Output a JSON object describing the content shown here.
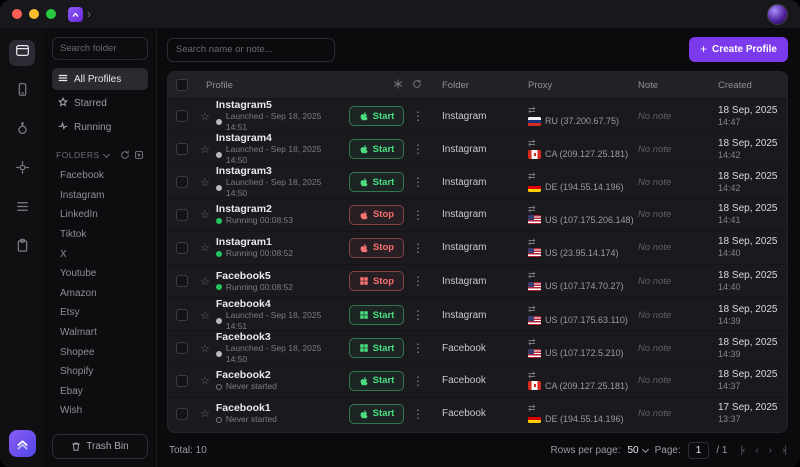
{
  "titlebar": {
    "chevron": "›"
  },
  "sidebar": {
    "search_placeholder": "Search folder",
    "nav": [
      {
        "label": "All Profiles"
      },
      {
        "label": "Starred"
      },
      {
        "label": "Running"
      }
    ],
    "folders_heading": "FOLDERS",
    "folders": [
      "Facebook",
      "Instagram",
      "LinkedIn",
      "Tiktok",
      "X",
      "Youtube",
      "Amazon",
      "Etsy",
      "Walmart",
      "Shopee",
      "Shopify",
      "Ebay",
      "Wish"
    ],
    "trash_button": "Trash Bin"
  },
  "toolbar": {
    "search_placeholder": "Search name or note...",
    "create_button": "Create Profile"
  },
  "table": {
    "headers": {
      "profile": "Profile",
      "folder": "Folder",
      "proxy": "Proxy",
      "note": "Note",
      "created": "Created"
    },
    "rows": [
      {
        "name": "Instagram5",
        "status": "Launched - Sep 18, 2025 14:51",
        "status_type": "launched",
        "action": "Start",
        "action_type": "start",
        "os": "apple",
        "folder": "Instagram",
        "proxy_country": "RU",
        "proxy": "RU (37.200.67.75)",
        "note": "No note",
        "created_date": "18 Sep, 2025",
        "created_time": "14:47"
      },
      {
        "name": "Instagram4",
        "status": "Launched - Sep 18, 2025 14:50",
        "status_type": "launched",
        "action": "Start",
        "action_type": "start",
        "os": "apple",
        "folder": "Instagram",
        "proxy_country": "CA",
        "proxy": "CA (209.127.25.181)",
        "note": "No note",
        "created_date": "18 Sep, 2025",
        "created_time": "14:42"
      },
      {
        "name": "Instagram3",
        "status": "Launched - Sep 18, 2025 14:50",
        "status_type": "launched",
        "action": "Start",
        "action_type": "start",
        "os": "apple",
        "folder": "Instagram",
        "proxy_country": "DE",
        "proxy": "DE (194.55.14.196)",
        "note": "No note",
        "created_date": "18 Sep, 2025",
        "created_time": "14:42"
      },
      {
        "name": "Instagram2",
        "status": "Running 00:08:53",
        "status_type": "running",
        "action": "Stop",
        "action_type": "stop",
        "os": "apple",
        "folder": "Instagram",
        "proxy_country": "US",
        "proxy": "US (107.175.206.148)",
        "note": "No note",
        "created_date": "18 Sep, 2025",
        "created_time": "14:41"
      },
      {
        "name": "Instagram1",
        "status": "Running 00:08:52",
        "status_type": "running",
        "action": "Stop",
        "action_type": "stop",
        "os": "apple",
        "folder": "Instagram",
        "proxy_country": "US",
        "proxy": "US (23.95.14.174)",
        "note": "No note",
        "created_date": "18 Sep, 2025",
        "created_time": "14:40"
      },
      {
        "name": "Facebook5",
        "status": "Running 00:08:52",
        "status_type": "running",
        "action": "Stop",
        "action_type": "stop",
        "os": "windows",
        "folder": "Instagram",
        "proxy_country": "US",
        "proxy": "US (107.174.70.27)",
        "note": "No note",
        "created_date": "18 Sep, 2025",
        "created_time": "14:40"
      },
      {
        "name": "Facebook4",
        "status": "Launched - Sep 18, 2025 14:51",
        "status_type": "launched",
        "action": "Start",
        "action_type": "start",
        "os": "windows",
        "folder": "Instagram",
        "proxy_country": "US",
        "proxy": "US (107.175.63.110)",
        "note": "No note",
        "created_date": "18 Sep, 2025",
        "created_time": "14:39"
      },
      {
        "name": "Facebook3",
        "status": "Launched - Sep 18, 2025 14:50",
        "status_type": "launched",
        "action": "Start",
        "action_type": "start",
        "os": "windows",
        "folder": "Facebook",
        "proxy_country": "US",
        "proxy": "US (107.172.5.210)",
        "note": "No note",
        "created_date": "18 Sep, 2025",
        "created_time": "14:39"
      },
      {
        "name": "Facebook2",
        "status": "Never started",
        "status_type": "never",
        "action": "Start",
        "action_type": "start",
        "os": "apple",
        "folder": "Facebook",
        "proxy_country": "CA",
        "proxy": "CA (209.127.25.181)",
        "note": "No note",
        "created_date": "18 Sep, 2025",
        "created_time": "14:37"
      },
      {
        "name": "Facebook1",
        "status": "Never started",
        "status_type": "never",
        "action": "Start",
        "action_type": "start",
        "os": "apple",
        "folder": "Facebook",
        "proxy_country": "DE",
        "proxy": "DE (194.55.14.196)",
        "note": "No note",
        "created_date": "17 Sep, 2025",
        "created_time": "13:37"
      }
    ]
  },
  "footer": {
    "total": "Total: 10",
    "rows_per_page_label": "Rows per page:",
    "rows_per_page_value": "50",
    "page_label": "Page:",
    "page_current": "1",
    "page_suffix": "/ 1"
  },
  "colors": {
    "accent": "#7c3aed",
    "start": "#4ade80",
    "stop": "#f87171"
  }
}
